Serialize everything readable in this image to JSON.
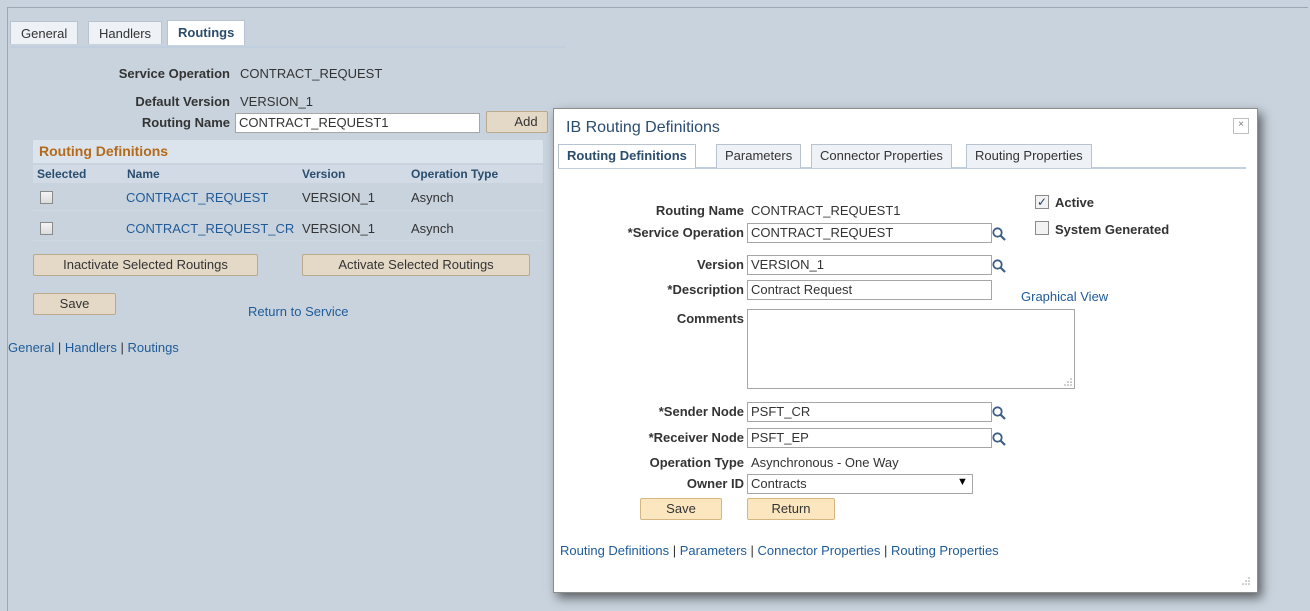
{
  "tabs": [
    "General",
    "Handlers",
    "Routings"
  ],
  "service_operation": {
    "label": "Service Operation",
    "value": "CONTRACT_REQUEST"
  },
  "default_version": {
    "label": "Default Version",
    "value": "VERSION_1"
  },
  "routing_name": {
    "label": "Routing Name",
    "value": "CONTRACT_REQUEST1"
  },
  "add_label": "Add",
  "grid": {
    "title": "Routing Definitions",
    "headers": [
      "Selected",
      "Name",
      "Version",
      "Operation Type"
    ],
    "rows": [
      {
        "name": "CONTRACT_REQUEST",
        "version": "VERSION_1",
        "op_type": "Asynch"
      },
      {
        "name": "CONTRACT_REQUEST_CR",
        "version": "VERSION_1",
        "op_type": "Asynch"
      }
    ]
  },
  "inactivate_label": "Inactivate Selected Routings",
  "activate_label": "Activate Selected Routings",
  "save_label": "Save",
  "return_service_label": "Return to Service",
  "bottom_links": [
    "General",
    "Handlers",
    "Routings"
  ],
  "modal": {
    "title": "IB Routing Definitions",
    "close": "×",
    "tabs": [
      "Routing Definitions",
      "Parameters",
      "Connector Properties",
      "Routing Properties"
    ],
    "routing_name_label": "Routing Name",
    "routing_name_value": "CONTRACT_REQUEST1",
    "service_operation_label": "*Service Operation",
    "service_operation_value": "CONTRACT_REQUEST",
    "version_label": "Version",
    "version_value": "VERSION_1",
    "description_label": "*Description",
    "description_value": "Contract Request",
    "comments_label": "Comments",
    "comments_value": "",
    "sender_label": "*Sender Node",
    "sender_value": "PSFT_CR",
    "receiver_label": "*Receiver Node",
    "receiver_value": "PSFT_EP",
    "op_type_label": "Operation Type",
    "op_type_value": "Asynchronous - One Way",
    "owner_label": "Owner ID",
    "owner_value": "Contracts",
    "active_label": "Active",
    "active_checked": true,
    "system_generated_label": "System Generated",
    "system_generated_checked": false,
    "graphical_view": "Graphical View",
    "save_label": "Save",
    "return_label": "Return",
    "bottom_links": [
      "Routing Definitions",
      "Parameters",
      "Connector Properties",
      "Routing Properties"
    ]
  },
  "colors": {
    "background": "#c9d3dd",
    "link": "#1f5b98",
    "grid_title": "#b56a1a",
    "button": "#e4d9c6"
  }
}
